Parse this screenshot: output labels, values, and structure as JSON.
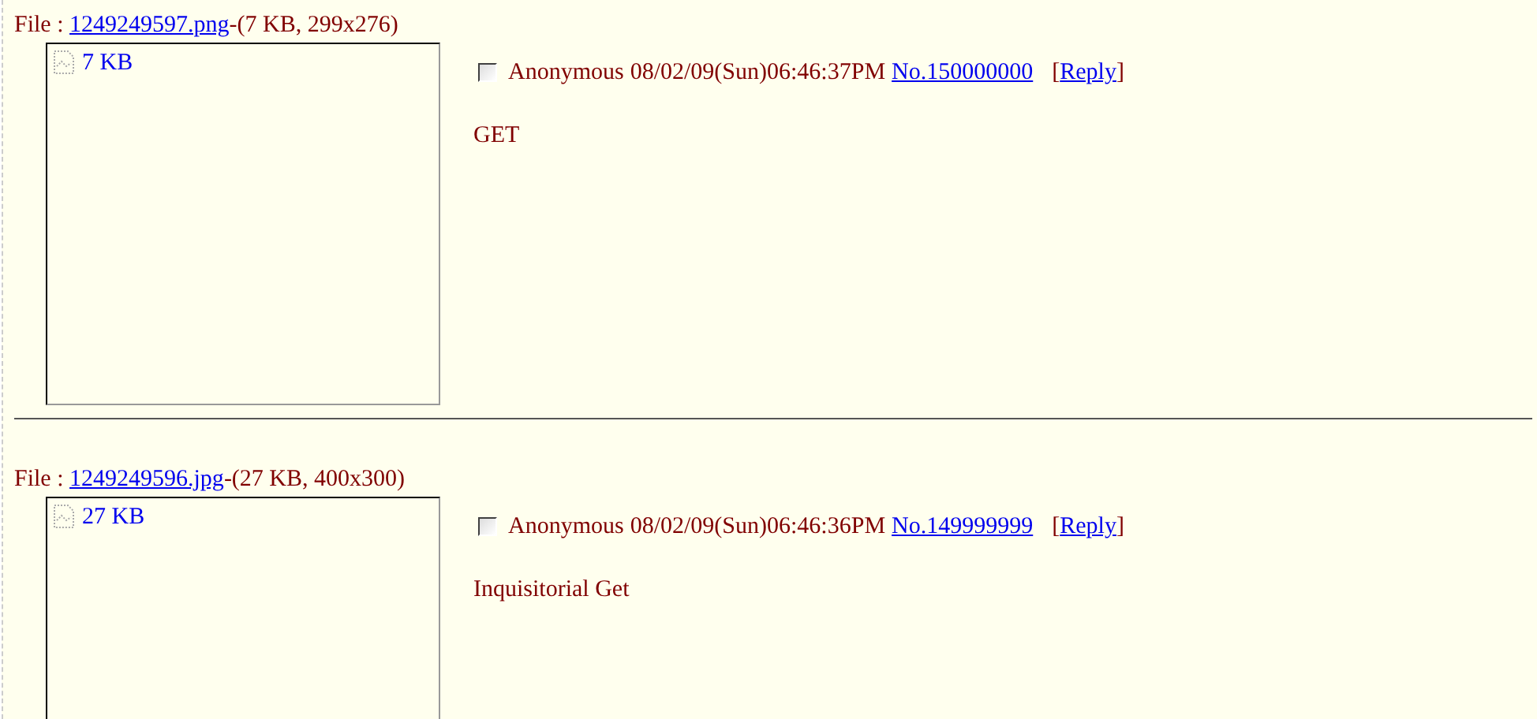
{
  "posts": [
    {
      "file_label": "File :",
      "file_name": "1249249597.png",
      "file_info": "-(7 KB, 299x276)",
      "thumb_size": "7 KB",
      "checked": false,
      "name": "Anonymous",
      "date": "08/02/09(Sun)06:46:37PM",
      "number": "No.150000000",
      "reply_open": "[",
      "reply": "Reply",
      "reply_close": "]",
      "comment": "GET"
    },
    {
      "file_label": "File :",
      "file_name": "1249249596.jpg",
      "file_info": "-(27 KB, 400x300)",
      "thumb_size": "27 KB",
      "checked": false,
      "name": "Anonymous",
      "date": "08/02/09(Sun)06:46:36PM",
      "number": "No.149999999",
      "reply_open": "[",
      "reply": "Reply",
      "reply_close": "]",
      "comment": "Inquisitorial Get"
    }
  ]
}
